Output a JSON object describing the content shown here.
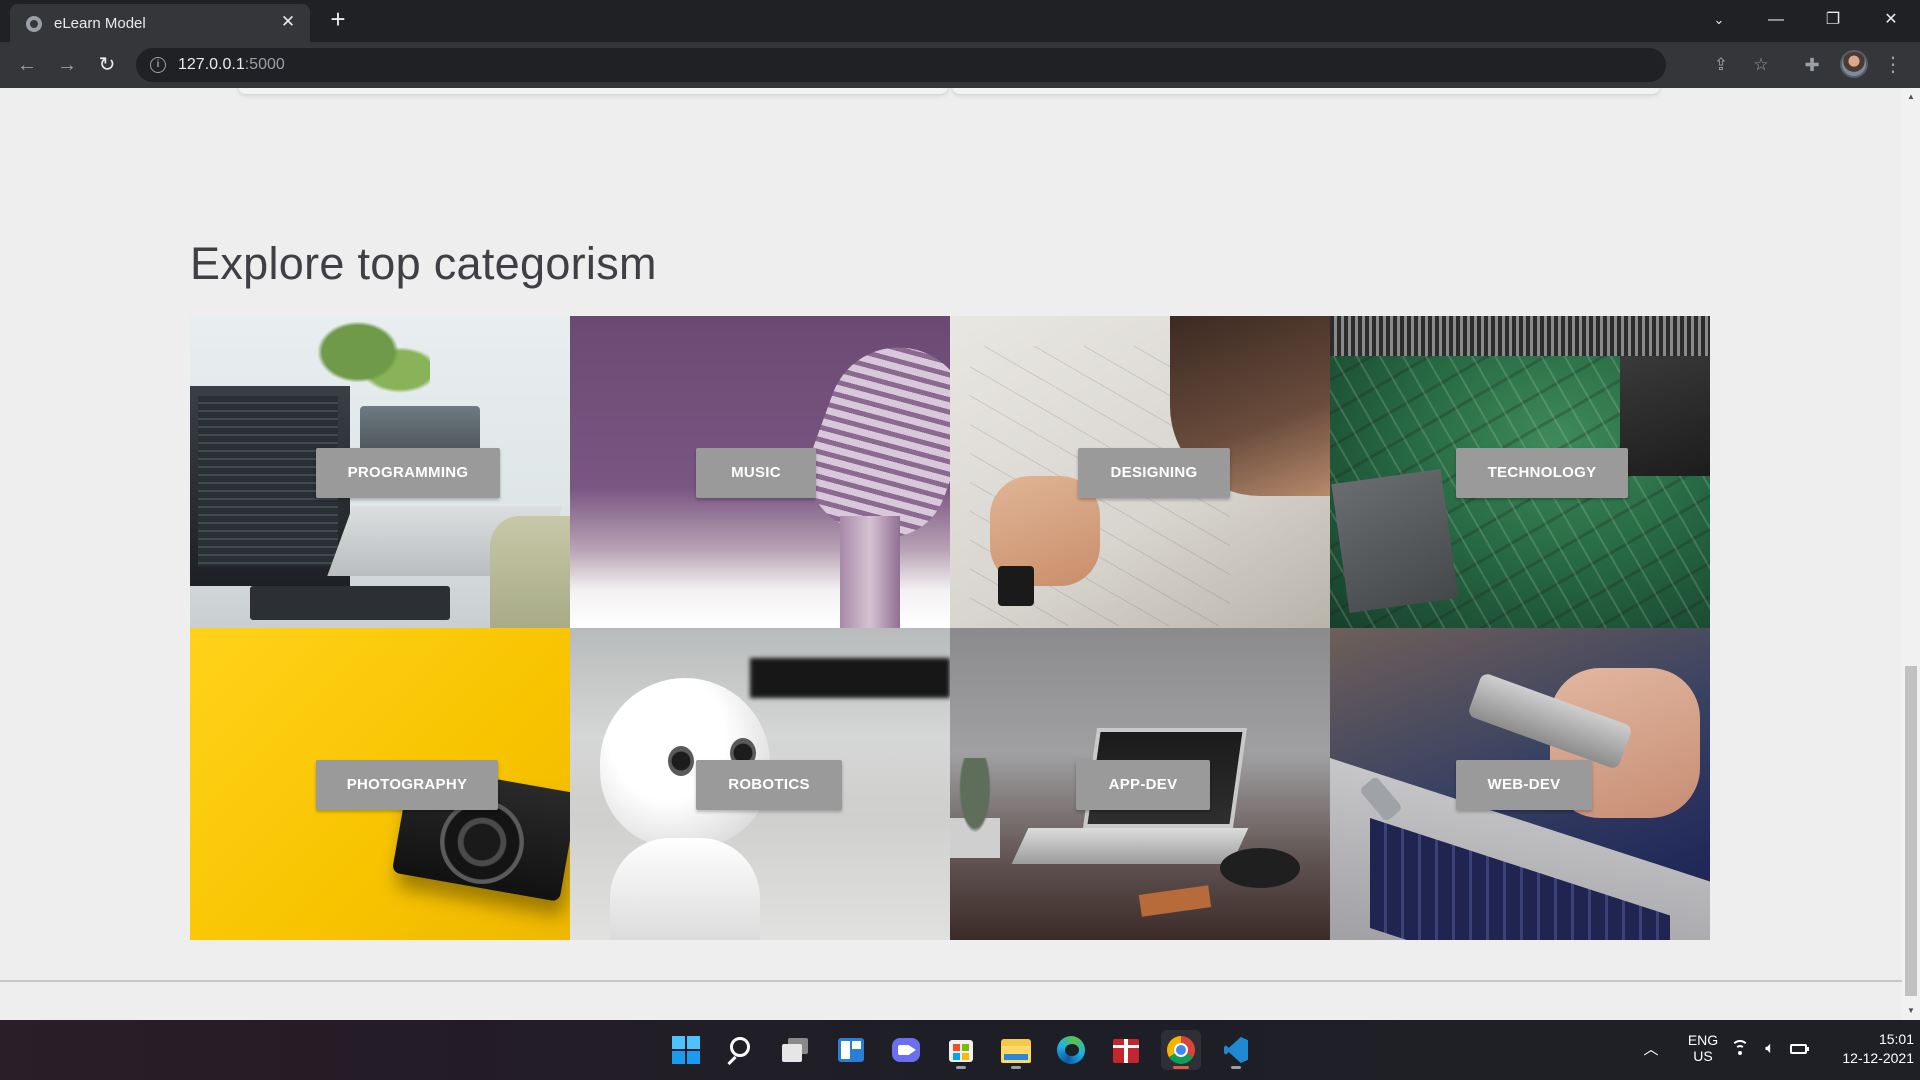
{
  "browser": {
    "tab_title": "eLearn Model",
    "url_host": "127.0.0.1",
    "url_port": ":5000"
  },
  "page": {
    "section_title": "Explore top categorism",
    "categories": [
      {
        "label": "PROGRAMMING",
        "image": "desk-computer-laptop-photo"
      },
      {
        "label": "MUSIC",
        "image": "vintage-microphone-photo"
      },
      {
        "label": "DESIGNING",
        "image": "designer-sketching-photo"
      },
      {
        "label": "TECHNOLOGY",
        "image": "circuit-board-photo"
      },
      {
        "label": "PHOTOGRAPHY",
        "image": "camera-on-yellow-photo"
      },
      {
        "label": "ROBOTICS",
        "image": "white-robot-photo"
      },
      {
        "label": "APP-DEV",
        "image": "laptop-on-table-photo"
      },
      {
        "label": "WEB-DEV",
        "image": "phone-and-laptop-photo"
      }
    ]
  },
  "taskbar": {
    "lang_line1": "ENG",
    "lang_line2": "US",
    "time": "15:01",
    "date": "12-12-2021",
    "apps": [
      "start-icon",
      "search-icon",
      "task-view-icon",
      "widgets-icon",
      "teams-chat-icon",
      "microsoft-store-icon",
      "file-explorer-icon",
      "edge-icon",
      "gift-app-icon",
      "chrome-icon",
      "vscode-icon"
    ]
  }
}
